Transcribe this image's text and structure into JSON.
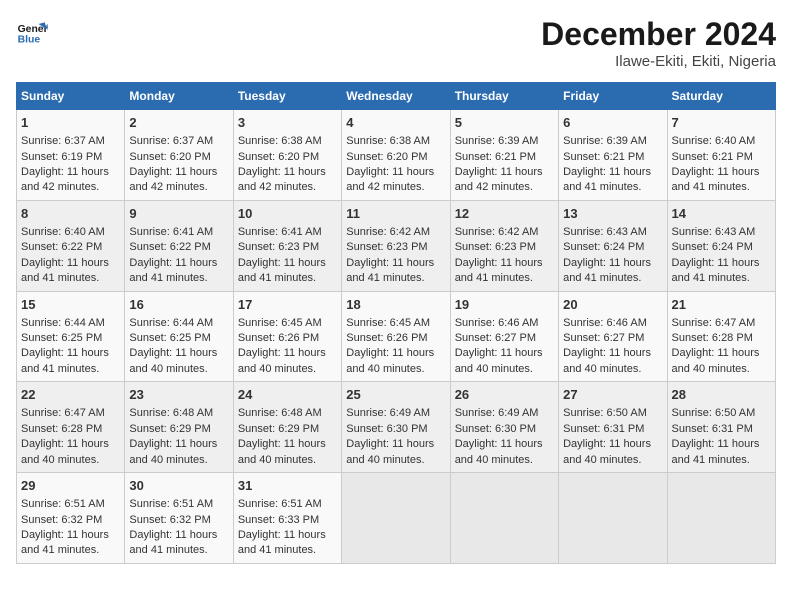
{
  "header": {
    "logo_line1": "General",
    "logo_line2": "Blue",
    "title": "December 2024",
    "subtitle": "Ilawe-Ekiti, Ekiti, Nigeria"
  },
  "days_of_week": [
    "Sunday",
    "Monday",
    "Tuesday",
    "Wednesday",
    "Thursday",
    "Friday",
    "Saturday"
  ],
  "weeks": [
    [
      {
        "day": "1",
        "rise": "6:37 AM",
        "set": "6:19 PM",
        "daylight": "11 hours and 42 minutes."
      },
      {
        "day": "2",
        "rise": "6:37 AM",
        "set": "6:20 PM",
        "daylight": "11 hours and 42 minutes."
      },
      {
        "day": "3",
        "rise": "6:38 AM",
        "set": "6:20 PM",
        "daylight": "11 hours and 42 minutes."
      },
      {
        "day": "4",
        "rise": "6:38 AM",
        "set": "6:20 PM",
        "daylight": "11 hours and 42 minutes."
      },
      {
        "day": "5",
        "rise": "6:39 AM",
        "set": "6:21 PM",
        "daylight": "11 hours and 42 minutes."
      },
      {
        "day": "6",
        "rise": "6:39 AM",
        "set": "6:21 PM",
        "daylight": "11 hours and 41 minutes."
      },
      {
        "day": "7",
        "rise": "6:40 AM",
        "set": "6:21 PM",
        "daylight": "11 hours and 41 minutes."
      }
    ],
    [
      {
        "day": "8",
        "rise": "6:40 AM",
        "set": "6:22 PM",
        "daylight": "11 hours and 41 minutes."
      },
      {
        "day": "9",
        "rise": "6:41 AM",
        "set": "6:22 PM",
        "daylight": "11 hours and 41 minutes."
      },
      {
        "day": "10",
        "rise": "6:41 AM",
        "set": "6:23 PM",
        "daylight": "11 hours and 41 minutes."
      },
      {
        "day": "11",
        "rise": "6:42 AM",
        "set": "6:23 PM",
        "daylight": "11 hours and 41 minutes."
      },
      {
        "day": "12",
        "rise": "6:42 AM",
        "set": "6:23 PM",
        "daylight": "11 hours and 41 minutes."
      },
      {
        "day": "13",
        "rise": "6:43 AM",
        "set": "6:24 PM",
        "daylight": "11 hours and 41 minutes."
      },
      {
        "day": "14",
        "rise": "6:43 AM",
        "set": "6:24 PM",
        "daylight": "11 hours and 41 minutes."
      }
    ],
    [
      {
        "day": "15",
        "rise": "6:44 AM",
        "set": "6:25 PM",
        "daylight": "11 hours and 41 minutes."
      },
      {
        "day": "16",
        "rise": "6:44 AM",
        "set": "6:25 PM",
        "daylight": "11 hours and 40 minutes."
      },
      {
        "day": "17",
        "rise": "6:45 AM",
        "set": "6:26 PM",
        "daylight": "11 hours and 40 minutes."
      },
      {
        "day": "18",
        "rise": "6:45 AM",
        "set": "6:26 PM",
        "daylight": "11 hours and 40 minutes."
      },
      {
        "day": "19",
        "rise": "6:46 AM",
        "set": "6:27 PM",
        "daylight": "11 hours and 40 minutes."
      },
      {
        "day": "20",
        "rise": "6:46 AM",
        "set": "6:27 PM",
        "daylight": "11 hours and 40 minutes."
      },
      {
        "day": "21",
        "rise": "6:47 AM",
        "set": "6:28 PM",
        "daylight": "11 hours and 40 minutes."
      }
    ],
    [
      {
        "day": "22",
        "rise": "6:47 AM",
        "set": "6:28 PM",
        "daylight": "11 hours and 40 minutes."
      },
      {
        "day": "23",
        "rise": "6:48 AM",
        "set": "6:29 PM",
        "daylight": "11 hours and 40 minutes."
      },
      {
        "day": "24",
        "rise": "6:48 AM",
        "set": "6:29 PM",
        "daylight": "11 hours and 40 minutes."
      },
      {
        "day": "25",
        "rise": "6:49 AM",
        "set": "6:30 PM",
        "daylight": "11 hours and 40 minutes."
      },
      {
        "day": "26",
        "rise": "6:49 AM",
        "set": "6:30 PM",
        "daylight": "11 hours and 40 minutes."
      },
      {
        "day": "27",
        "rise": "6:50 AM",
        "set": "6:31 PM",
        "daylight": "11 hours and 40 minutes."
      },
      {
        "day": "28",
        "rise": "6:50 AM",
        "set": "6:31 PM",
        "daylight": "11 hours and 41 minutes."
      }
    ],
    [
      {
        "day": "29",
        "rise": "6:51 AM",
        "set": "6:32 PM",
        "daylight": "11 hours and 41 minutes."
      },
      {
        "day": "30",
        "rise": "6:51 AM",
        "set": "6:32 PM",
        "daylight": "11 hours and 41 minutes."
      },
      {
        "day": "31",
        "rise": "6:51 AM",
        "set": "6:33 PM",
        "daylight": "11 hours and 41 minutes."
      },
      null,
      null,
      null,
      null
    ]
  ]
}
